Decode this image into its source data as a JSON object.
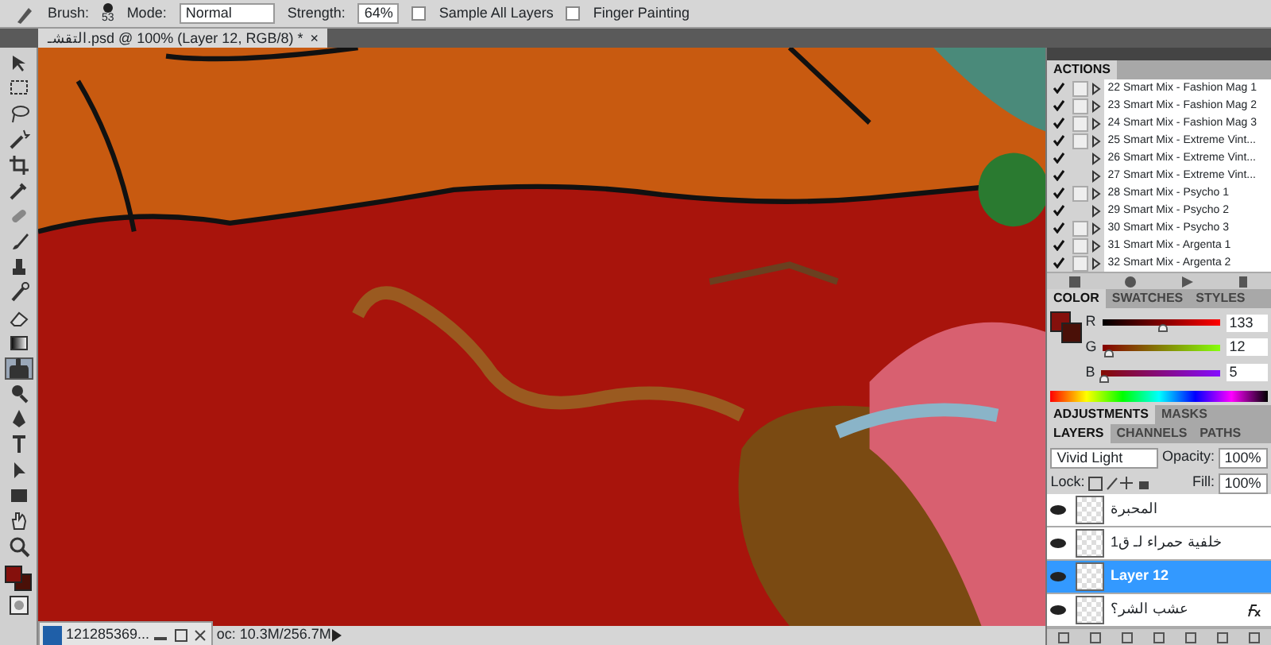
{
  "options_bar": {
    "brush_label": "Brush:",
    "brush_size": "53",
    "mode_label": "Mode:",
    "mode_value": "Normal",
    "strength_label": "Strength:",
    "strength_value": "64%",
    "options": [
      {
        "label": "Sample All Layers",
        "checked": false
      },
      {
        "label": "Finger Painting",
        "checked": false
      }
    ]
  },
  "document_tab": {
    "title": "التقشـ.psd @ 100% (Layer 12, RGB/8) *",
    "close": "×"
  },
  "tools": [
    {
      "kind": "move",
      "selected": false
    },
    {
      "kind": "marquee",
      "selected": false
    },
    {
      "kind": "lasso",
      "selected": false
    },
    {
      "kind": "wand",
      "selected": false
    },
    {
      "kind": "crop",
      "selected": false
    },
    {
      "kind": "eyedropper",
      "selected": false
    },
    {
      "kind": "healing",
      "selected": false
    },
    {
      "kind": "brush",
      "selected": false
    },
    {
      "kind": "stamp",
      "selected": false
    },
    {
      "kind": "history",
      "selected": false
    },
    {
      "kind": "eraser",
      "selected": false
    },
    {
      "kind": "gradient",
      "selected": false
    },
    {
      "kind": "smudge",
      "selected": true
    },
    {
      "kind": "dodge",
      "selected": false
    },
    {
      "kind": "pen",
      "selected": false
    },
    {
      "kind": "type",
      "selected": false
    },
    {
      "kind": "select",
      "selected": false
    },
    {
      "kind": "shape",
      "selected": false
    },
    {
      "kind": "hand",
      "selected": false
    },
    {
      "kind": "zoom",
      "selected": false
    }
  ],
  "swatches": [
    {
      "kind": "foreground",
      "color": "#85100c"
    },
    {
      "kind": "background",
      "color": "#4a1008"
    }
  ],
  "actions_panel": {
    "tabs": [
      {
        "label": "ACTIONS",
        "selected": true
      }
    ],
    "items": [
      {
        "label": "22 Smart Mix - Fashion Mag 1",
        "checked": true,
        "dialog": true
      },
      {
        "label": "23 Smart Mix - Fashion Mag 2",
        "checked": true,
        "dialog": true
      },
      {
        "label": "24 Smart Mix - Fashion Mag 3",
        "checked": true,
        "dialog": true
      },
      {
        "label": "25 Smart Mix - Extreme Vint...",
        "checked": true,
        "dialog": true
      },
      {
        "label": "26 Smart Mix - Extreme Vint...",
        "checked": true,
        "dialog": false
      },
      {
        "label": "27 Smart Mix - Extreme Vint...",
        "checked": true,
        "dialog": false
      },
      {
        "label": "28 Smart Mix - Psycho 1",
        "checked": true,
        "dialog": true
      },
      {
        "label": "29 Smart Mix - Psycho 2",
        "checked": true,
        "dialog": false
      },
      {
        "label": "30 Smart Mix - Psycho 3",
        "checked": true,
        "dialog": true
      },
      {
        "label": "31 Smart Mix - Argenta 1",
        "checked": true,
        "dialog": true
      },
      {
        "label": "32 Smart Mix - Argenta 2",
        "checked": true,
        "dialog": true
      }
    ]
  },
  "color_panel": {
    "tabs": [
      {
        "label": "COLOR",
        "selected": true
      },
      {
        "label": "SWATCHES",
        "selected": false
      },
      {
        "label": "STYLES",
        "selected": false
      }
    ],
    "channels": [
      {
        "name": "R",
        "value": "133",
        "level": 0.52
      },
      {
        "name": "G",
        "value": "12",
        "level": 0.05
      },
      {
        "name": "B",
        "value": "5",
        "level": 0.02
      }
    ]
  },
  "adjustments_panel": {
    "tabs": [
      {
        "label": "ADJUSTMENTS",
        "selected": true
      },
      {
        "label": "MASKS",
        "selected": false
      }
    ]
  },
  "layers_panel": {
    "tabs": [
      {
        "label": "LAYERS",
        "selected": true
      },
      {
        "label": "CHANNELS",
        "selected": false
      },
      {
        "label": "PATHS",
        "selected": false
      }
    ],
    "blend_mode": "Vivid Light",
    "opacity_label": "Opacity:",
    "opacity": "100%",
    "lock_label": "Lock:",
    "fill_label": "Fill:",
    "fill": "100%",
    "layers": [
      {
        "name": "المحبرة",
        "visible": true,
        "selected": false,
        "fx": false
      },
      {
        "name": "خلفية حمراء لـ ق1",
        "visible": true,
        "selected": false,
        "fx": false
      },
      {
        "name": "Layer 12",
        "visible": true,
        "selected": true,
        "fx": false
      },
      {
        "name": "عشب الشر؟",
        "visible": true,
        "selected": false,
        "fx": true
      }
    ]
  },
  "status_bar": {
    "doc_size": "oc: 10.3M/256.7M"
  },
  "taskbar_item": {
    "title": "121285369..."
  }
}
